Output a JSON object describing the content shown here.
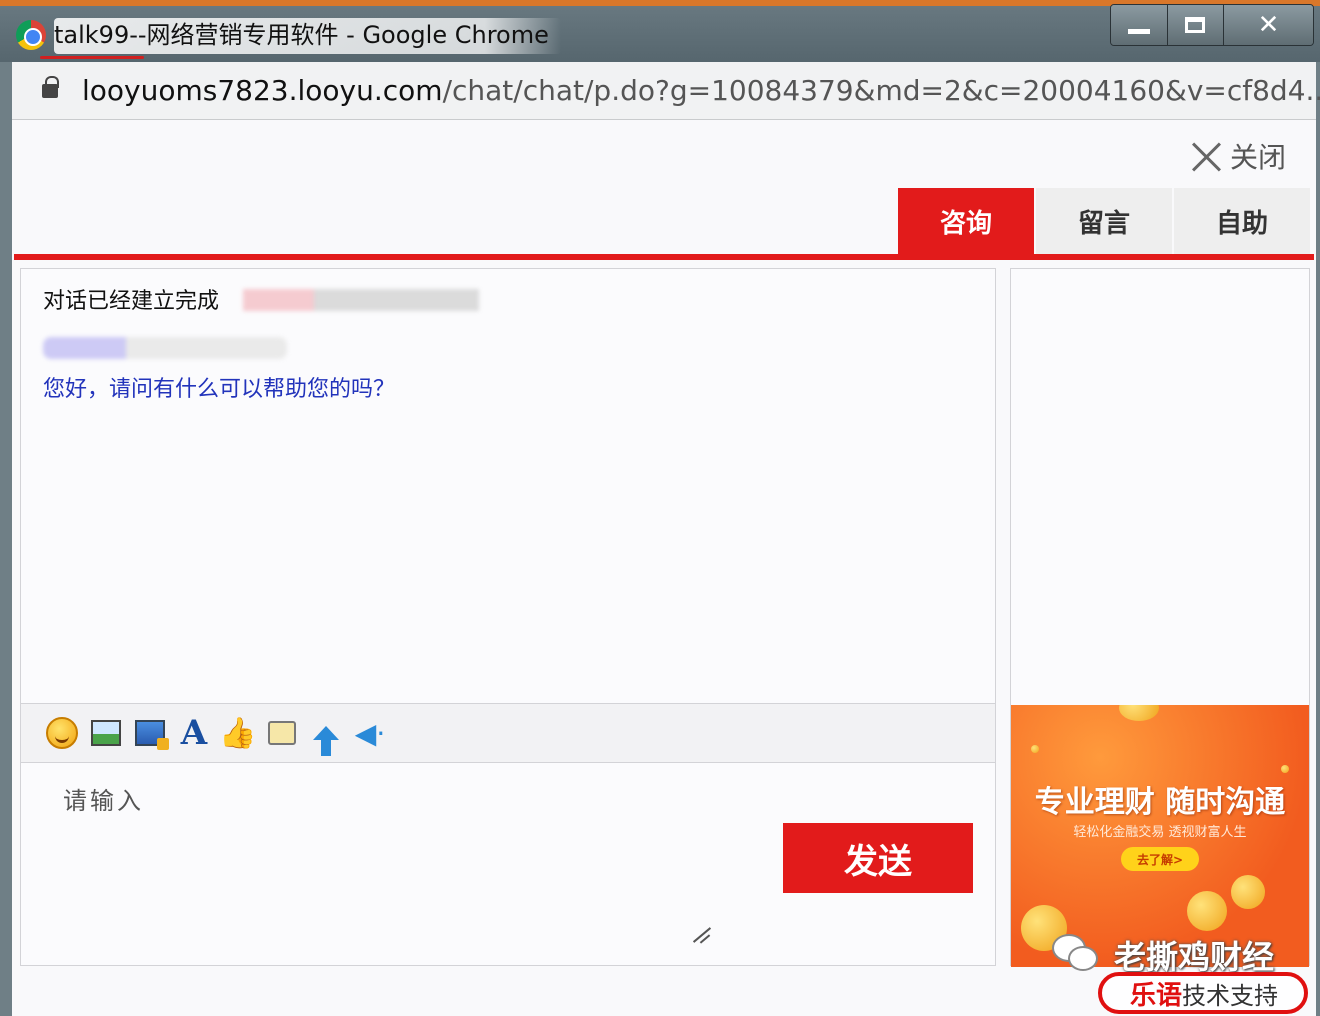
{
  "window": {
    "title": "talk99--网络营销专用软件 - Google Chrome",
    "controls": {
      "minimize": "",
      "maximize": "",
      "close": "✕"
    }
  },
  "address": {
    "host": "looyuoms7823.looyu.com",
    "path": "/chat/chat/p.do?g=10084379&md=2&c=20004160&v=cf8d4..."
  },
  "page": {
    "close_label": "关闭",
    "tabs": [
      {
        "label": "咨询",
        "active": true
      },
      {
        "label": "留言",
        "active": false
      },
      {
        "label": "自助",
        "active": false
      }
    ],
    "chat": {
      "system_message": "对话已经建立完成",
      "greeting": "您好，请问有什么可以帮助您的吗？"
    },
    "toolbar_icons": [
      "emoji-icon",
      "image-icon",
      "screenshot-icon",
      "font-icon",
      "thumbs-up-icon",
      "message-icon",
      "upload-icon",
      "speaker-icon"
    ],
    "input": {
      "placeholder": "请输入"
    },
    "send_label": "发送",
    "ad": {
      "title": "专业理财 随时沟通",
      "subtitle": "轻松化金融交易 透视财富人生",
      "cta": "去了解>"
    }
  },
  "watermark": {
    "account": "老撕鸡财经",
    "support_brand": "乐语",
    "support_text": "技术支持"
  },
  "colors": {
    "accent": "#e21b1b",
    "greeting": "#2233bb",
    "ad_bg": "#f25c1f"
  }
}
